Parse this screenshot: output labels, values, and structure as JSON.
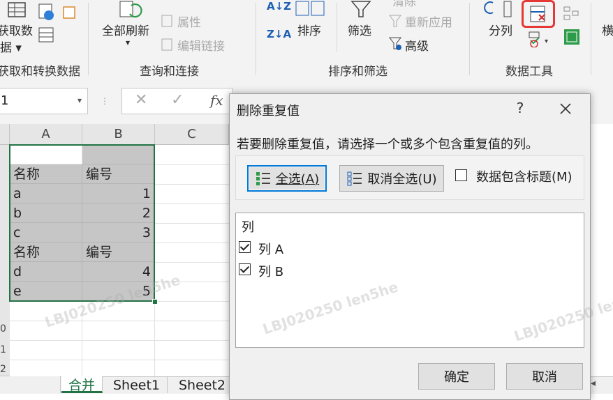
{
  "ribbon": {
    "get_data": [
      "获取数",
      "据"
    ],
    "get_transform_group": "获取和转换数据",
    "refresh_all": "全部刷新",
    "connections": "查询和连接",
    "properties": "属性",
    "edit_links": "编辑链接",
    "query_group": "查询和连接",
    "sort": "排序",
    "filter": "筛选",
    "clear": "清除",
    "reapply": "重新应用",
    "advanced": "高级",
    "sort_filter_group": "排序和筛选",
    "text_to_columns": "分列",
    "data_tools_group": "数据工具",
    "forecast_partial": "横",
    "highlight_color": "#e53935"
  },
  "formula_bar": {
    "name_box": "1",
    "fx": "fx"
  },
  "grid": {
    "columns": [
      "A",
      "B",
      "C"
    ],
    "rows": [
      [
        "",
        ""
      ],
      [
        "名称",
        "编号"
      ],
      [
        "a",
        "1"
      ],
      [
        "b",
        "2"
      ],
      [
        "c",
        "3"
      ],
      [
        "名称",
        "编号"
      ],
      [
        "d",
        "4"
      ],
      [
        "e",
        "5"
      ]
    ],
    "row_numbers": [
      "0",
      "1",
      "2"
    ]
  },
  "sheet_tabs": [
    "合并",
    "Sheet1",
    "Sheet2"
  ],
  "dialog": {
    "title": "删除重复值",
    "help": "?",
    "description": "若要删除重复值，请选择一个或多个包含重复值的列。",
    "select_all": "全选(A)",
    "unselect_all": "取消全选(U)",
    "has_headers": "数据包含标题(M)",
    "has_headers_checked": false,
    "list_header": "列",
    "columns": [
      {
        "label": "列 A",
        "checked": true
      },
      {
        "label": "列 B",
        "checked": true
      }
    ],
    "ok": "确定",
    "cancel": "取消"
  },
  "watermark": "LBJ020250 len5he"
}
